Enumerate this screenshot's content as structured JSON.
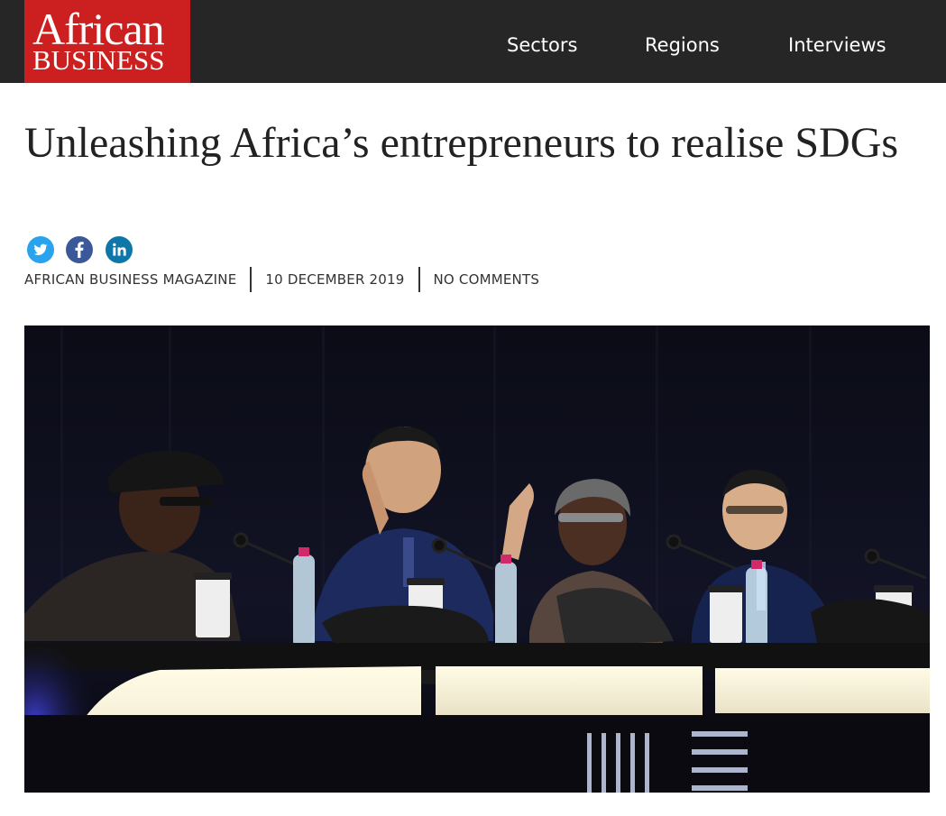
{
  "header": {
    "logo_line1": "African",
    "logo_line2": "BUSINESS",
    "nav": [
      "Sectors",
      "Regions",
      "Interviews"
    ]
  },
  "article": {
    "title": "Unleashing Africa’s entrepreneurs to realise SDGs",
    "share_icons": [
      "twitter-icon",
      "facebook-icon",
      "linkedin-icon"
    ],
    "author": "AFRICAN BUSINESS MAGAZINE",
    "date": "10 DECEMBER 2019",
    "comments": "NO COMMENTS",
    "hero_image": "photo of four panelists seated at a stage table with microphones and water bottles"
  },
  "colors": {
    "brand_red": "#cc1f1f",
    "topbar": "#262626",
    "twitter": "#2aa3ef",
    "facebook": "#3b5998",
    "linkedin": "#0e76a8"
  }
}
